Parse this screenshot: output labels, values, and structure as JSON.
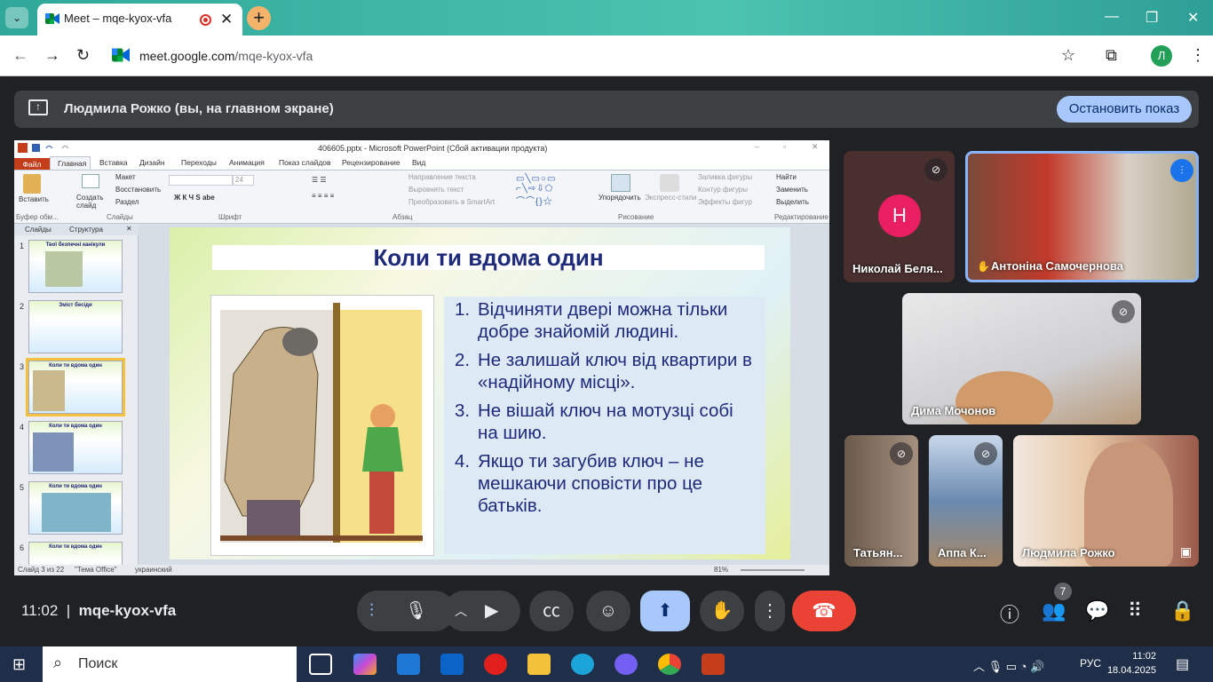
{
  "browser": {
    "tab_title": "Meet – mqe-kyox-vfa",
    "url_host": "meet.google.com",
    "url_path": "/mqe-kyox-vfa",
    "profile_initial": "Л"
  },
  "banner": {
    "presenting_text": "Людмила Рожко (вы, на главном экране)",
    "stop_label": "Остановить показ"
  },
  "ppt": {
    "window_title": "406605.pptx - Microsoft PowerPoint (Сбой активации продукта)",
    "tabs": [
      "Файл",
      "Главная",
      "Вставка",
      "Дизайн",
      "Переходы",
      "Анимация",
      "Показ слайдов",
      "Рецензирование",
      "Вид"
    ],
    "ribbon": {
      "paste": "Вставить",
      "create_slide": "Создать слайд",
      "layout": "Макет",
      "reset": "Восстановить",
      "section": "Раздел",
      "font_size": "24",
      "text_dir": "Направление текста",
      "align_text": "Выровнять текст",
      "smartart": "Преобразовать в SmartArt",
      "arrange": "Упорядочить",
      "quick_styles": "Экспресс-стили",
      "fill": "Заливка фигуры",
      "outline": "Контур фигуры",
      "effects": "Эффекты фигур",
      "find": "Найти",
      "replace": "Заменить",
      "select": "Выделить",
      "groups": {
        "clipboard": "Буфер обм...",
        "slides": "Слайды",
        "font": "Шрифт",
        "paragraph": "Абзац",
        "drawing": "Рисование",
        "editing": "Редактирование"
      }
    },
    "panel_tabs": [
      "Слайды",
      "Структура"
    ],
    "thumbs": [
      {
        "num": "1",
        "title": "Твої безпечні канікули"
      },
      {
        "num": "2",
        "title": "Зміст бесіди"
      },
      {
        "num": "3",
        "title": "Коли ти вдома один"
      },
      {
        "num": "4",
        "title": "Коли ти вдома один"
      },
      {
        "num": "5",
        "title": "Коли ти вдома один"
      },
      {
        "num": "6",
        "title": "Коли ти вдома один"
      }
    ],
    "slide": {
      "title": "Коли ти вдома один",
      "items": [
        {
          "n": "1.",
          "text": "Відчиняти двері можна тільки добре знайомій людині."
        },
        {
          "n": "2.",
          "text": "Не залишай ключ від квартири в «надійному місці»."
        },
        {
          "n": "3.",
          "text": "Не вішай ключ на мотузці собі на шию."
        },
        {
          "n": "4.",
          "text": "Якщо ти загубив ключ – не мешкаючи сповісти про це батьків."
        }
      ]
    },
    "status": {
      "slide_of": "Слайд 3 из 22",
      "theme": "\"Тема Office\"",
      "lang": "украинский",
      "zoom": "81%"
    }
  },
  "participants": [
    {
      "name": "Николай Беля...",
      "initial": "Н",
      "muted": true
    },
    {
      "name": "Антоніна Самочернова",
      "muted": false
    },
    {
      "name": "Дима Мочонов",
      "muted": true
    },
    {
      "name": "Татьян...",
      "muted": true
    },
    {
      "name": "Аппа К...",
      "muted": true
    },
    {
      "name": "Людмила Рожко",
      "muted": false
    }
  ],
  "meeting": {
    "time": "11:02",
    "code": "mqe-kyox-vfa",
    "people_count": "7"
  },
  "taskbar": {
    "search": "Поиск",
    "lang": "РУС",
    "time": "11:02",
    "date": "18.04.2025"
  }
}
